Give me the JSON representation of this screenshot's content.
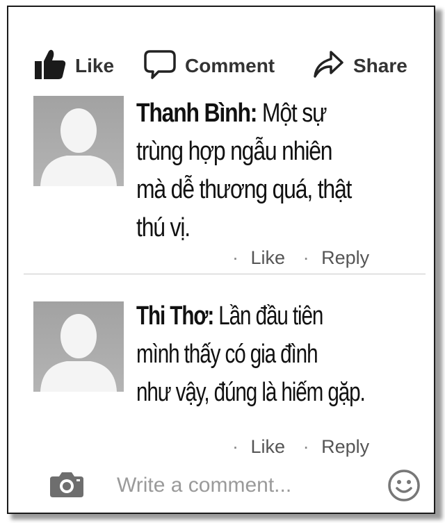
{
  "actions": {
    "like_label": "Like",
    "comment_label": "Comment",
    "share_label": "Share"
  },
  "comments": [
    {
      "author": "Thanh Bình:",
      "lines": [
        " Một sự",
        "trùng hợp ngẫu nhiên",
        "mà dễ thương quá, thật",
        "thú vị."
      ],
      "like_label": "Like",
      "reply_label": "Reply"
    },
    {
      "author": "Thi Thơ:",
      "lines": [
        " Lần đầu tiên",
        "mình thấy có gia đình",
        "như vậy, đúng là hiếm gặp."
      ],
      "like_label": "Like",
      "reply_label": "Reply"
    }
  ],
  "composer": {
    "placeholder": "Write a comment..."
  },
  "icons": {
    "like": "thumbs-up-icon",
    "comment": "speech-bubble-icon",
    "share": "share-arrow-icon",
    "camera": "camera-icon",
    "emoji": "smiley-icon"
  }
}
